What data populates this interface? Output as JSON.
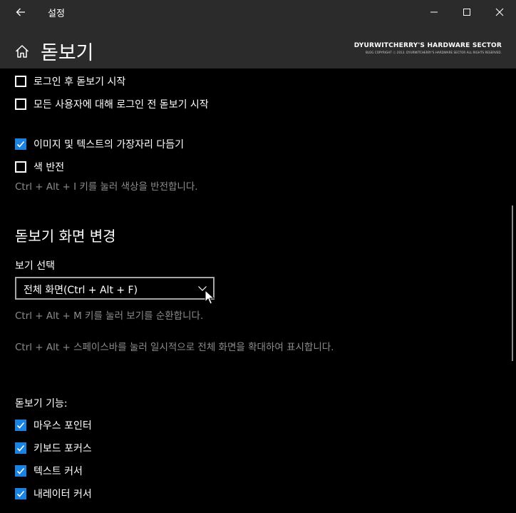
{
  "titlebar": {
    "title": "설정"
  },
  "header": {
    "page_title": "돋보기",
    "watermark_main": "DYURWITCHERRY'S HARDWARE SECTOR",
    "watermark_sub": "BLOG COPYRIGHT ⓒ 2013. DYURWITCHERRY'S HARDWARE SECTOR ALL RIGHTS RESERVED."
  },
  "options_top": [
    {
      "label": "로그인 후 돋보기 시작",
      "checked": false
    },
    {
      "label": "모든 사용자에 대해 로그인 전 돋보기 시작",
      "checked": false
    }
  ],
  "options_mid": [
    {
      "label": "이미지 및 텍스트의 가장자리 다듬기",
      "checked": true
    },
    {
      "label": "색 반전",
      "checked": false
    }
  ],
  "invert_hint": "Ctrl + Alt + I 키를 눌러 색상을 반전합니다.",
  "view_section": {
    "title": "돋보기 화면 변경",
    "view_label": "보기 선택",
    "view_value": "전체 화면(Ctrl + Alt + F)",
    "cycle_hint": "Ctrl + Alt + M 키를 눌러 보기를 순환합니다.",
    "space_hint": "Ctrl + Alt + 스페이스바를 눌러 일시적으로 전체 화면을 확대하여 표시합니다."
  },
  "features": {
    "label": "돋보기 기능:",
    "items": [
      {
        "label": "마우스 포인터",
        "checked": true
      },
      {
        "label": "키보드 포커스",
        "checked": true
      },
      {
        "label": "텍스트 커서",
        "checked": true
      },
      {
        "label": "내레이터 커서",
        "checked": true
      }
    ]
  },
  "colors": {
    "accent": "#1a82e0",
    "chrome": "#2b2b2b",
    "background": "#000000",
    "hint_text": "#8c8c8c"
  },
  "icons": {
    "back": "arrow-left-icon",
    "minimize": "minimize-icon",
    "maximize": "maximize-icon",
    "close": "close-icon",
    "home": "home-icon",
    "checkmark": "checkmark-icon",
    "chevron": "chevron-down-icon",
    "cursor": "mouse-cursor-icon"
  }
}
